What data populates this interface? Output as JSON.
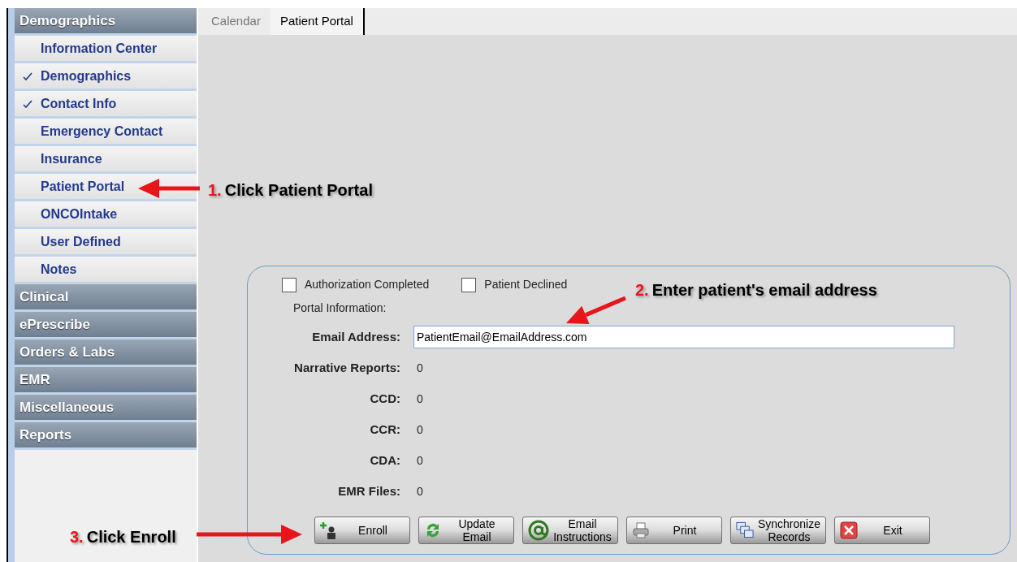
{
  "sidebar": {
    "sections": [
      {
        "title": "Demographics",
        "items": [
          {
            "label": "Information Center",
            "checked": false
          },
          {
            "label": "Demographics",
            "checked": true
          },
          {
            "label": "Contact Info",
            "checked": true
          },
          {
            "label": "Emergency Contact",
            "checked": false
          },
          {
            "label": "Insurance",
            "checked": false
          },
          {
            "label": "Patient Portal",
            "checked": false
          },
          {
            "label": "ONCOIntake",
            "checked": false
          },
          {
            "label": "User Defined",
            "checked": false
          },
          {
            "label": "Notes",
            "checked": false
          }
        ]
      },
      {
        "title": "Clinical"
      },
      {
        "title": "ePrescribe"
      },
      {
        "title": "Orders & Labs"
      },
      {
        "title": "EMR"
      },
      {
        "title": "Miscellaneous"
      },
      {
        "title": "Reports"
      }
    ]
  },
  "tabs": [
    {
      "label": "Calendar",
      "selected": false
    },
    {
      "label": "Patient Portal",
      "selected": true
    }
  ],
  "portal": {
    "checkboxes": [
      {
        "label": "Authorization Completed",
        "checked": false
      },
      {
        "label": "Patient Declined",
        "checked": false
      }
    ],
    "section_label": "Portal Information:",
    "email": {
      "label": "Email Address:",
      "value": "PatientEmail@EmailAddress.com"
    },
    "fields": [
      {
        "label": "Narrative Reports:",
        "value": "0"
      },
      {
        "label": "CCD:",
        "value": "0"
      },
      {
        "label": "CCR:",
        "value": "0"
      },
      {
        "label": "CDA:",
        "value": "0"
      },
      {
        "label": "EMR Files:",
        "value": "0"
      }
    ],
    "buttons": [
      {
        "kind": "enroll",
        "label": "Enroll"
      },
      {
        "kind": "update",
        "label": "Update\nEmail"
      },
      {
        "kind": "email",
        "label": "Email\nInstructions"
      },
      {
        "kind": "print",
        "label": "Print"
      },
      {
        "kind": "sync",
        "label": "Synchronize\nRecords"
      },
      {
        "kind": "exit",
        "label": "Exit"
      }
    ]
  },
  "annotations": [
    {
      "number": "1.",
      "text": "Click Patient Portal"
    },
    {
      "number": "2.",
      "text": "Enter patient's email address"
    },
    {
      "number": "3.",
      "text": "Click Enroll"
    }
  ]
}
